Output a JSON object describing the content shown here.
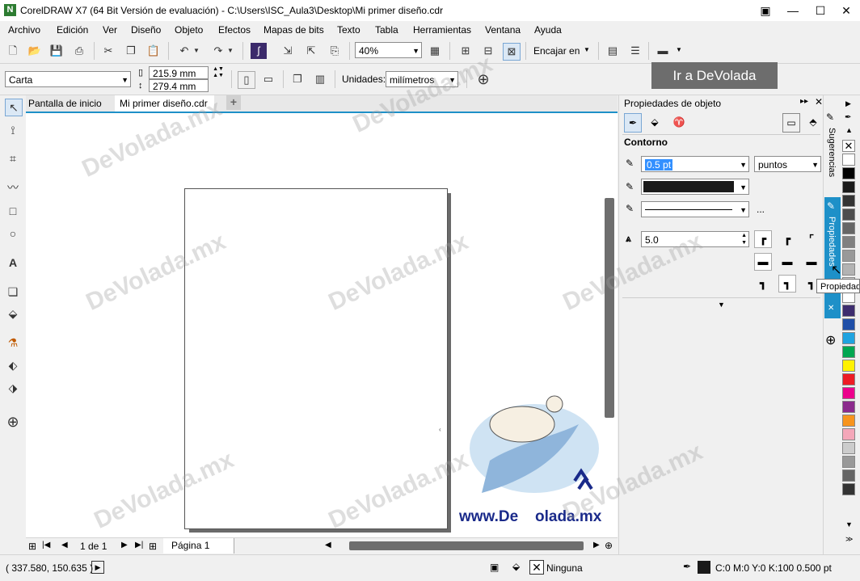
{
  "window": {
    "title": "CorelDRAW X7 (64 Bit Versión de evaluación) - C:\\Users\\ISC_Aula3\\Desktop\\Mi primer diseño.cdr",
    "app_icon": "corel-icon"
  },
  "menu": [
    "Archivo",
    "Edición",
    "Ver",
    "Diseño",
    "Objeto",
    "Efectos",
    "Mapas de bits",
    "Texto",
    "Tabla",
    "Herramientas",
    "Ventana",
    "Ayuda"
  ],
  "toolbar1": {
    "zoom": "40%",
    "fit_label": "Encajar en"
  },
  "toolbar2": {
    "paper_size": "Carta",
    "width": "215.9 mm",
    "height": "279.4 mm",
    "units_label": "Unidades:",
    "units_value": "milímetros"
  },
  "ad_button": "Ir a DeVolada",
  "doc_tabs": [
    "Pantalla de inicio",
    "Mi primer diseño.cdr"
  ],
  "page_nav": {
    "page_count": "1 de 1",
    "page_tab": "Página 1"
  },
  "panel": {
    "title": "Propiedades de objeto",
    "section": "Contorno",
    "width_value": "0.5 pt",
    "width_unit": "puntos",
    "miter_value": "5.0",
    "more": "..."
  },
  "side_tabs": {
    "hints": "Sugerencias",
    "properties": "Propiedades"
  },
  "tooltip": "Propiedades",
  "status": {
    "coords": "( 337.580, 150.635 )",
    "fill": "Ninguna",
    "outline": "C:0 M:0 Y:0 K:100  0.500 pt"
  },
  "logo": {
    "url_left": "www.De",
    "url_right": "olada.mx"
  },
  "watermark": "DeVolada.mx",
  "palette": [
    "#ffffff",
    "#000000",
    "#1a1a1a",
    "#333333",
    "#4d4d4d",
    "#666666",
    "#808080",
    "#999999",
    "#b3b3b3",
    "#cccccc",
    "#ffffff",
    "#3d2d6e",
    "#1f4fa8",
    "#1fa3e0",
    "#00a651",
    "#fff200",
    "#ed1c24",
    "#ec008c",
    "#8b2a8c",
    "#f7941d",
    "#f4a7b9",
    "#cccccc",
    "#999999",
    "#666666",
    "#333333"
  ]
}
